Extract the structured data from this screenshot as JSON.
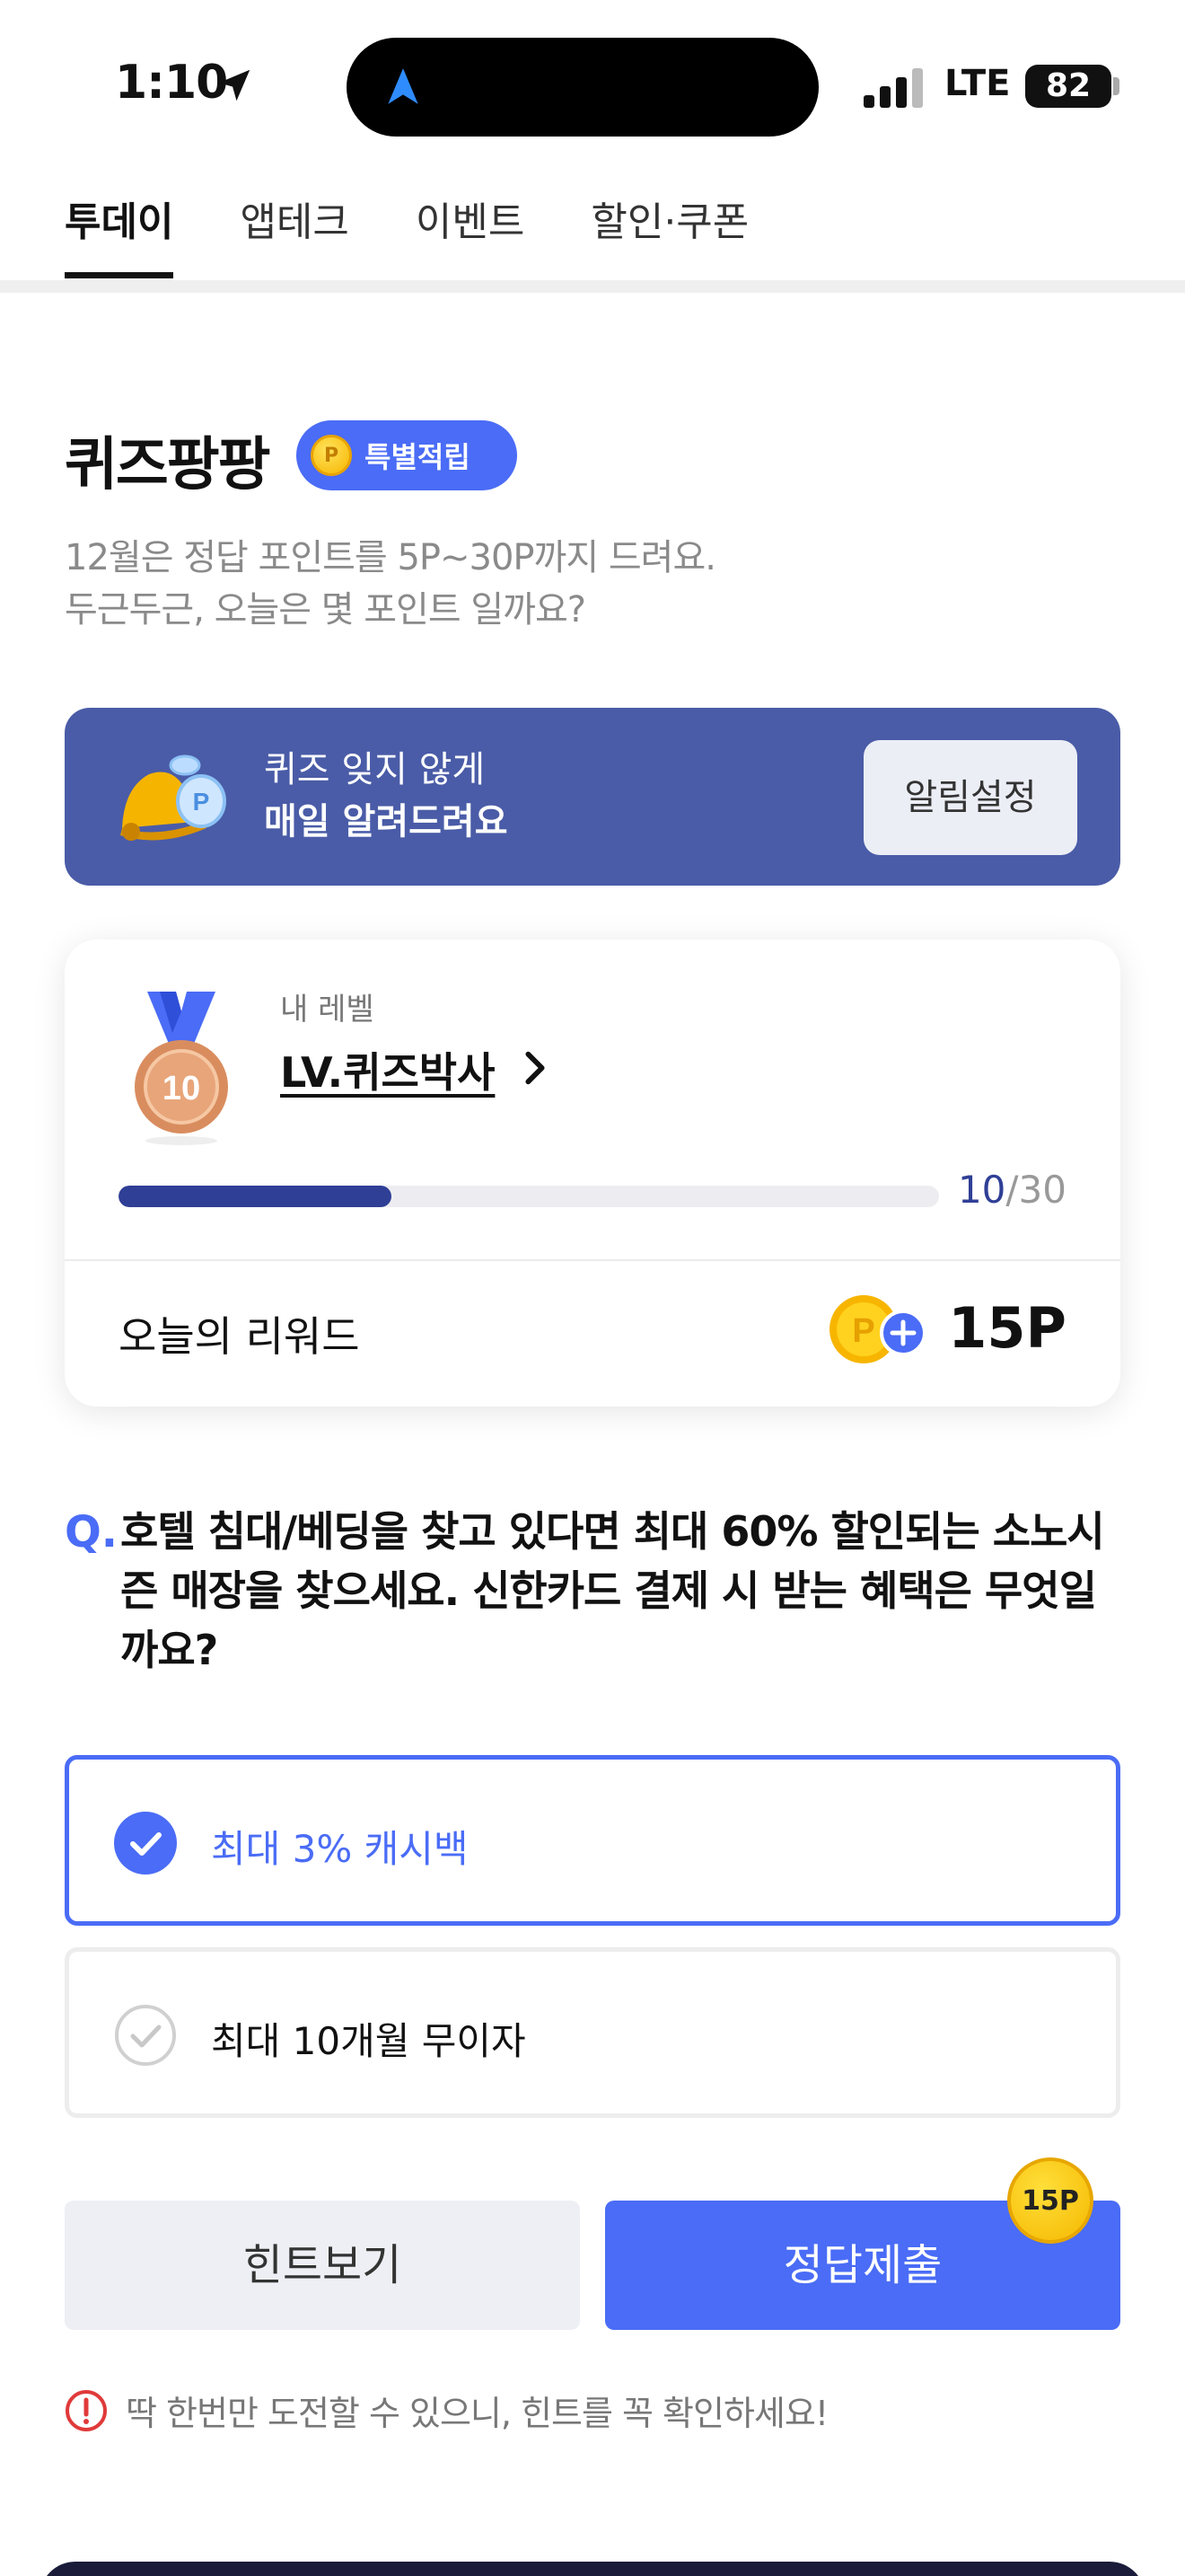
{
  "status_bar": {
    "time": "1:10",
    "network": "LTE",
    "battery": "82"
  },
  "tabs": [
    {
      "label": "투데이",
      "active": true
    },
    {
      "label": "앱테크",
      "active": false
    },
    {
      "label": "이벤트",
      "active": false
    },
    {
      "label": "할인·쿠폰",
      "active": false
    }
  ],
  "header": {
    "title": "퀴즈팡팡",
    "badge_label": "특별적립",
    "badge_coin": "P",
    "subtitle_line1": "12월은 정답 포인트를 5P~30P까지 드려요.",
    "subtitle_line2": "두근두근, 오늘은 몇 포인트 일까요?"
  },
  "alarm_banner": {
    "line1": "퀴즈 잊지 않게",
    "line2": "매일 알려드려요",
    "button_label": "알림설정"
  },
  "level_card": {
    "my_level_label": "내 레벨",
    "level_name": "LV.퀴즈박사",
    "medal_number": "10",
    "progress_current": "10",
    "progress_total": "/30",
    "progress_fraction": 0.333,
    "reward_label": "오늘의 리워드",
    "reward_value": "15P"
  },
  "question": {
    "prefix": "Q.",
    "text": "호텔 침대/베딩을 찾고 있다면 최대 60% 할인되는 소노시즌 매장을 찾으세요. 신한카드 결제 시 받는 혜택은 무엇일까요?"
  },
  "options": [
    {
      "label": "최대 3% 캐시백",
      "selected": true
    },
    {
      "label": "최대 10개월 무이자",
      "selected": false
    }
  ],
  "actions": {
    "hint_label": "힌트보기",
    "submit_label": "정답제출",
    "submit_points": "15P"
  },
  "notice": "딱 한번만 도전할 수 있으니, 힌트를 꼭 확인하세요!",
  "colors": {
    "accent": "#4a6cf6",
    "banner": "#4a5ca7",
    "progress": "#2f3f96",
    "coin": "#f7b500"
  }
}
